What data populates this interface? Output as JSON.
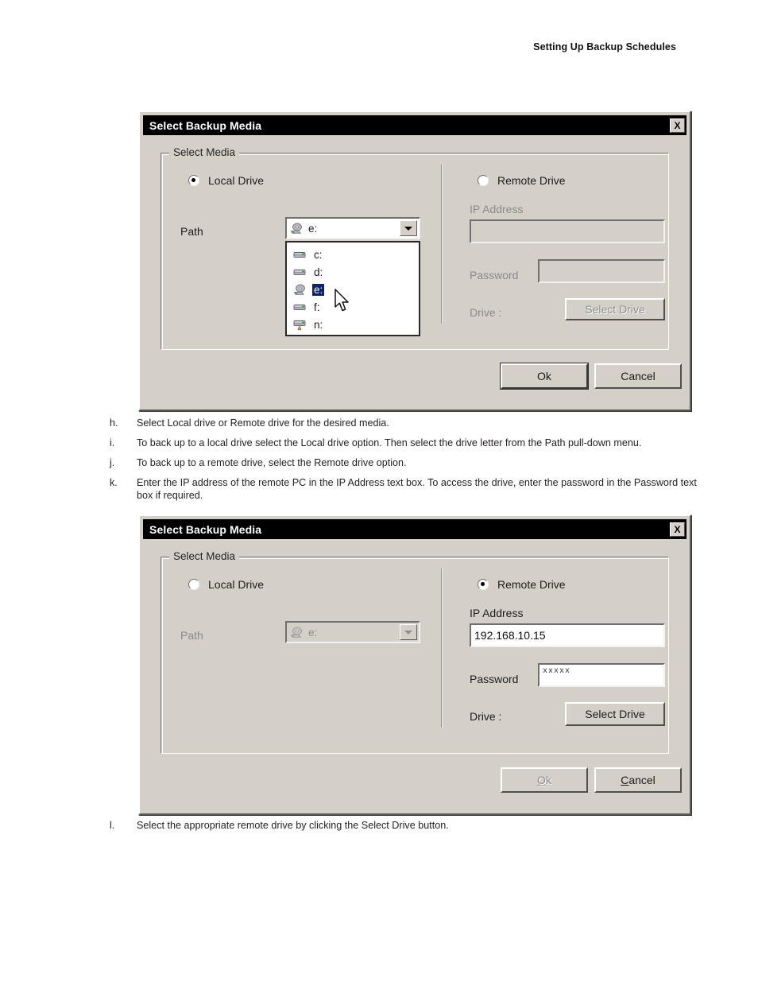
{
  "page": {
    "header": "Setting Up Backup Schedules"
  },
  "steps_upper": [
    {
      "marker": "h.",
      "text": "Select Local drive or Remote drive for the desired media."
    },
    {
      "marker": "i.",
      "text": "To back up to a local drive select the Local drive option. Then select the drive letter from the Path pull-down menu."
    },
    {
      "marker": "j.",
      "text": "To back up to a remote drive, select the Remote drive option."
    },
    {
      "marker": "k.",
      "text": "Enter the IP address of the remote PC in the IP Address text box. To access the drive, enter the password in the Password text box if required."
    }
  ],
  "steps_lower": [
    {
      "marker": "l.",
      "text": "Select the appropriate remote drive by clicking the Select Drive button."
    }
  ],
  "dialog1": {
    "title": "Select Backup Media",
    "close_icon": "close-icon",
    "close_label": "X",
    "groupbox_title": "Select Media",
    "local": {
      "radio_label": "Local Drive",
      "selected": true,
      "path_label": "Path",
      "combo_value": "e:",
      "combo_icon": "optical-drive-icon",
      "dropdown_open": true,
      "dropdown_items": [
        {
          "label": "c:",
          "icon": "hard-drive-icon",
          "selected": false
        },
        {
          "label": "d:",
          "icon": "hard-drive-icon",
          "selected": false
        },
        {
          "label": "e:",
          "icon": "optical-drive-icon",
          "selected": true
        },
        {
          "label": "f:",
          "icon": "hard-drive-icon",
          "selected": false
        },
        {
          "label": "n:",
          "icon": "network-drive-icon",
          "selected": false
        }
      ]
    },
    "remote": {
      "radio_label": "Remote Drive",
      "selected": false,
      "ip_label": "IP Address",
      "ip_value": "",
      "password_label": "Password",
      "password_value": "",
      "drive_label": "Drive :",
      "select_drive_label": "Select Drive",
      "enabled": false
    },
    "buttons": {
      "ok_label": "Ok",
      "ok_enabled": true,
      "ok_default": true,
      "cancel_label": "Cancel",
      "cancel_enabled": true
    }
  },
  "dialog2": {
    "title": "Select Backup Media",
    "close_icon": "close-icon",
    "close_label": "X",
    "groupbox_title": "Select Media",
    "local": {
      "radio_label": "Local Drive",
      "selected": false,
      "path_label": "Path",
      "combo_value": "e:",
      "combo_icon": "optical-drive-icon",
      "dropdown_open": false,
      "enabled": false
    },
    "remote": {
      "radio_label": "Remote Drive",
      "selected": true,
      "ip_label": "IP Address",
      "ip_value": "192.168.10.15",
      "password_label": "Password",
      "password_value": "xxxxx",
      "drive_label": "Drive :",
      "select_drive_label": "Select Drive",
      "enabled": true
    },
    "buttons": {
      "ok_label": "Ok",
      "ok_accel": "O",
      "ok_enabled": false,
      "cancel_label": "Cancel",
      "cancel_accel": "C",
      "cancel_enabled": true
    }
  },
  "colors": {
    "dialog_face": "#d4d0c8",
    "titlebar": "#000000",
    "selection": "#0a246a",
    "disabled_text": "#8d8d8d"
  }
}
